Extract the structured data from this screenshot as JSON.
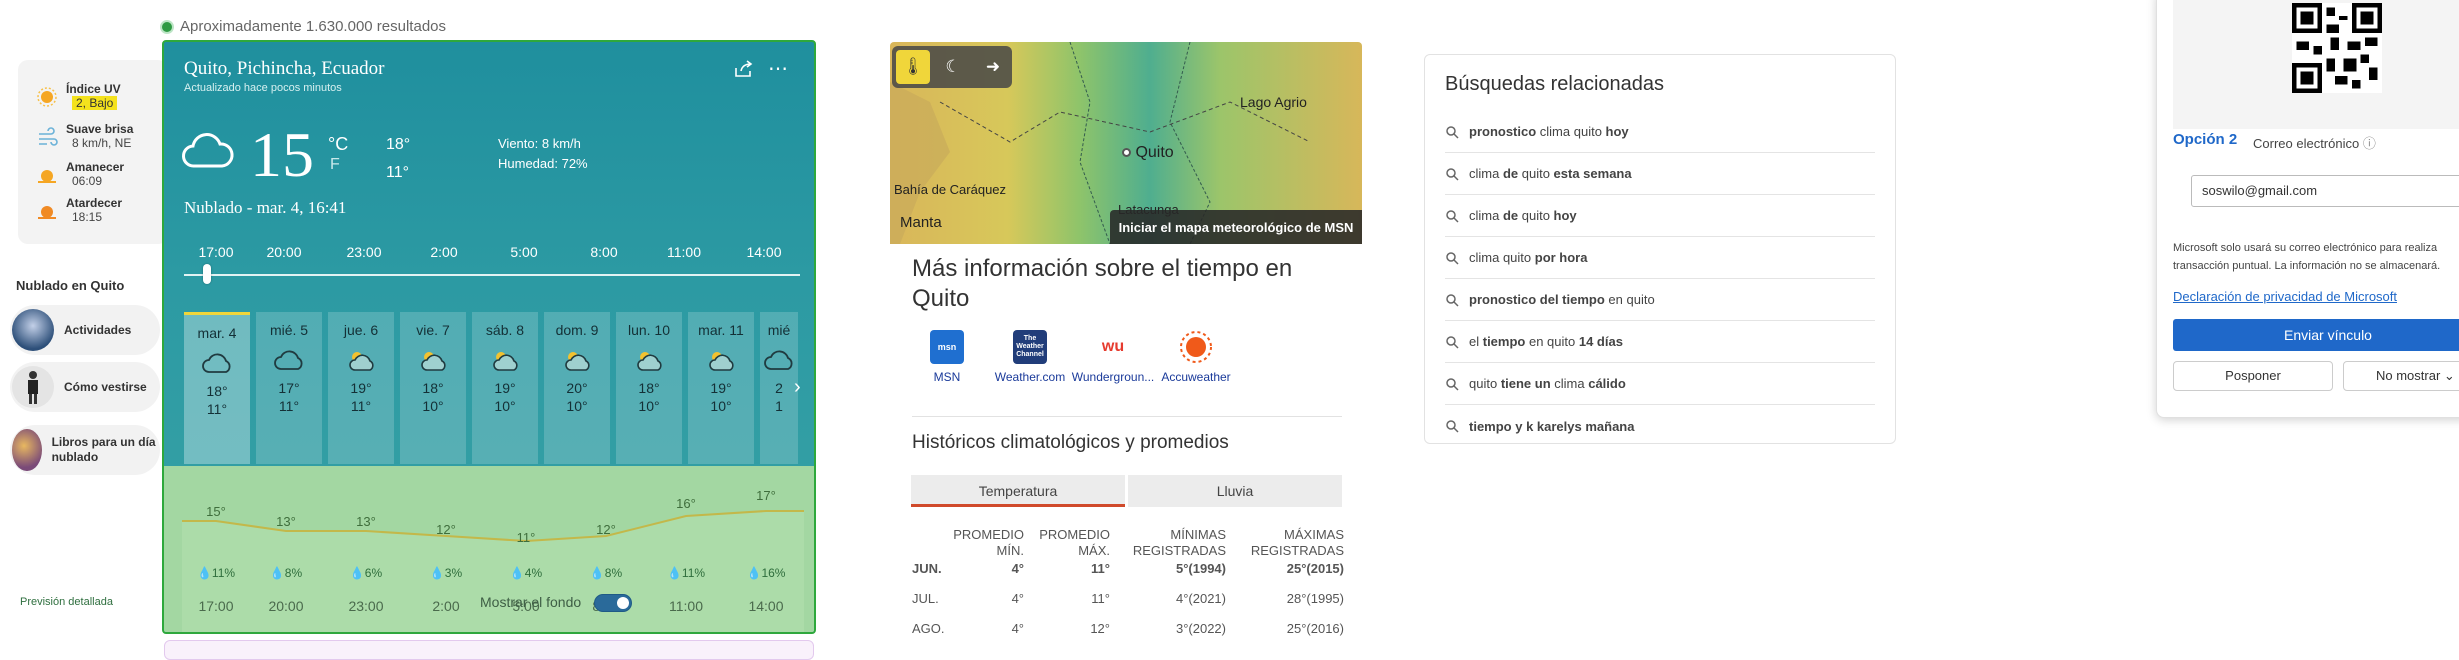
{
  "results": {
    "text": "Aproximadamente 1.630.000 resultados"
  },
  "conditions": {
    "uv": {
      "title": "Índice UV",
      "value": "2, Bajo"
    },
    "wind": {
      "title": "Suave brisa",
      "value": "8 km/h, NE"
    },
    "sunrise": {
      "title": "Amanecer",
      "value": "06:09"
    },
    "sunset": {
      "title": "Atardecer",
      "value": "18:15"
    }
  },
  "side": {
    "heading": "Nublado en Quito",
    "cards": [
      {
        "label": "Actividades",
        "color": "#2d4f79"
      },
      {
        "label": "Cómo vestirse",
        "color": "#ececec"
      },
      {
        "label": "Libros para un día nublado",
        "color": "#7a4a78"
      }
    ]
  },
  "weather": {
    "location": "Quito, Pichincha, Ecuador",
    "updated": "Actualizado hace pocos minutos",
    "temp": "15",
    "unit_c": "°C",
    "unit_f": "F",
    "high": "18°",
    "low": "11°",
    "wind": "Viento: 8 km/h",
    "humidity": "Humedad: 72%",
    "description": "Nublado - mar. 4, 16:41",
    "timeline_times": [
      "17:00",
      "20:00",
      "23:00",
      "2:00",
      "5:00",
      "8:00",
      "11:00",
      "14:00"
    ],
    "days": [
      {
        "name": "mar. 4",
        "hi": "18°",
        "lo": "11°",
        "icon": "cloudy-icon"
      },
      {
        "name": "mié. 5",
        "hi": "17°",
        "lo": "11°",
        "icon": "cloudy-icon"
      },
      {
        "name": "jue. 6",
        "hi": "19°",
        "lo": "11°",
        "icon": "partly-sunny-icon"
      },
      {
        "name": "vie. 7",
        "hi": "18°",
        "lo": "10°",
        "icon": "partly-sunny-icon"
      },
      {
        "name": "sáb. 8",
        "hi": "19°",
        "lo": "10°",
        "icon": "partly-sunny-icon"
      },
      {
        "name": "dom. 9",
        "hi": "20°",
        "lo": "10°",
        "icon": "partly-sunny-icon"
      },
      {
        "name": "lun. 10",
        "hi": "18°",
        "lo": "10°",
        "icon": "partly-sunny-icon"
      },
      {
        "name": "mar. 11",
        "hi": "19°",
        "lo": "10°",
        "icon": "partly-sunny-icon"
      },
      {
        "name": "mié",
        "hi": "2",
        "lo": "1",
        "icon": "cloudy-icon"
      }
    ],
    "hourly": {
      "temps": [
        "15°",
        "13°",
        "13°",
        "12°",
        "11°",
        "12°",
        "16°",
        "17°"
      ],
      "rain": [
        "11%",
        "8%",
        "6%",
        "3%",
        "4%",
        "8%",
        "11%",
        "16%"
      ],
      "times": [
        "17:00",
        "20:00",
        "23:00",
        "2:00",
        "5:00",
        "8:00",
        "11:00",
        "14:00"
      ]
    },
    "detail_link": "Previsión detallada",
    "bg_toggle": "Mostrar el fondo"
  },
  "map": {
    "cities": [
      "Lago Agrio",
      "Quito",
      "Bahía de Caráquez",
      "Manta",
      "Latacunga"
    ],
    "cta": "Iniciar el mapa meteorológico de MSN"
  },
  "more": {
    "title": "Más información sobre el tiempo en Quito",
    "providers": [
      {
        "name": "MSN",
        "color": "#1f6fd0",
        "logo": "msn"
      },
      {
        "name": "Weather.com",
        "color": "#213d7a",
        "logo": "The Weather Channel"
      },
      {
        "name": "Wundergroun...",
        "color": "#ffffff",
        "logo": "wu"
      },
      {
        "name": "Accuweather",
        "color": "#f05a1a",
        "logo": ""
      }
    ]
  },
  "history": {
    "title": "Históricos climatológicos y promedios",
    "tabs": [
      "Temperatura",
      "Lluvia"
    ],
    "headers": [
      "PROMEDIO MÍN.",
      "PROMEDIO MÁX.",
      "MÍNIMAS REGISTRADAS",
      "MÁXIMAS REGISTRADAS"
    ],
    "rows": [
      {
        "month": "JUN.",
        "min": "4°",
        "max": "11°",
        "rec_min": "5°(1994)",
        "rec_max": "25°(2015)",
        "bold": true
      },
      {
        "month": "JUL.",
        "min": "4°",
        "max": "11°",
        "rec_min": "4°(2021)",
        "rec_max": "28°(1995)",
        "bold": false
      },
      {
        "month": "AGO.",
        "min": "4°",
        "max": "12°",
        "rec_min": "3°(2022)",
        "rec_max": "25°(2016)",
        "bold": false
      }
    ]
  },
  "related": {
    "title": "Búsquedas relacionadas",
    "items": [
      "pronostico clima quito hoy",
      "clima de quito esta semana",
      "clima de quito hoy",
      "clima quito por hora",
      "pronostico del tiempo en quito",
      "el tiempo en quito 14 días",
      "quito tiene un clima cálido",
      "tiempo y k karelys mañana"
    ]
  },
  "popup": {
    "option": "Opción 2",
    "option_sub": "Correo electrónico",
    "email": "soswilo@gmail.com",
    "notice": "Microsoft solo usará su correo electrónico para realiza transacción puntual. La información no se almacenará.",
    "privacy": "Declaración de privacidad de Microsoft",
    "send": "Enviar vínculo",
    "postpone": "Posponer",
    "nomostrar": "No mostrar"
  }
}
